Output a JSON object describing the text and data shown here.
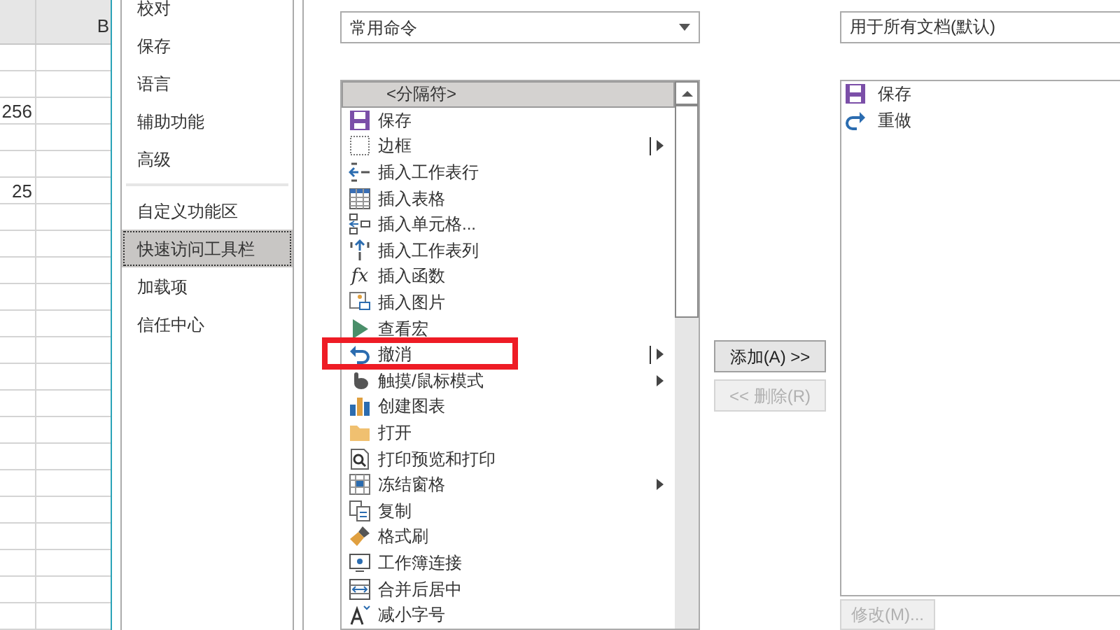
{
  "spreadsheet": {
    "column_header": "B",
    "values": [
      {
        "text": "256"
      },
      {
        "text": "25"
      }
    ]
  },
  "nav": {
    "items": [
      {
        "label": "校对",
        "selected": false
      },
      {
        "label": "保存",
        "selected": false
      },
      {
        "label": "语言",
        "selected": false
      },
      {
        "label": "辅助功能",
        "selected": false
      },
      {
        "label": "高级",
        "selected": false
      },
      {
        "label": "自定义功能区",
        "selected": false
      },
      {
        "label": "快速访问工具栏",
        "selected": true
      },
      {
        "label": "加载项",
        "selected": false
      },
      {
        "label": "信任中心",
        "selected": false
      }
    ]
  },
  "commands": {
    "dropdown": {
      "value": "常用命令"
    },
    "items": [
      {
        "label": "<分隔符>",
        "kind": "separator",
        "selected": true
      },
      {
        "label": "保存",
        "kind": "plain",
        "selected": false
      },
      {
        "label": "边框",
        "kind": "split",
        "selected": false
      },
      {
        "label": "插入工作表行",
        "kind": "plain",
        "selected": false
      },
      {
        "label": "插入表格",
        "kind": "plain",
        "selected": false
      },
      {
        "label": "插入单元格...",
        "kind": "plain",
        "selected": false
      },
      {
        "label": "插入工作表列",
        "kind": "plain",
        "selected": false
      },
      {
        "label": "插入函数",
        "kind": "plain",
        "selected": false,
        "icon_text": "fx"
      },
      {
        "label": "插入图片",
        "kind": "plain",
        "selected": false
      },
      {
        "label": "查看宏",
        "kind": "plain",
        "selected": false
      },
      {
        "label": "撤消",
        "kind": "split",
        "selected": false
      },
      {
        "label": "触摸/鼠标模式",
        "kind": "submenu",
        "selected": false
      },
      {
        "label": "创建图表",
        "kind": "plain",
        "selected": false
      },
      {
        "label": "打开",
        "kind": "plain",
        "selected": false
      },
      {
        "label": "打印预览和打印",
        "kind": "plain",
        "selected": false
      },
      {
        "label": "冻结窗格",
        "kind": "submenu",
        "selected": false
      },
      {
        "label": "复制",
        "kind": "plain",
        "selected": false
      },
      {
        "label": "格式刷",
        "kind": "plain",
        "selected": false
      },
      {
        "label": "工作簿连接",
        "kind": "plain",
        "selected": false
      },
      {
        "label": "合并后居中",
        "kind": "plain",
        "selected": false
      },
      {
        "label": "减小字号",
        "kind": "plain",
        "selected": false
      }
    ]
  },
  "add_button": {
    "label": "添加(A) >>",
    "disabled": false
  },
  "remove_button": {
    "label": "<< 删除(R)",
    "disabled": true
  },
  "toolbar": {
    "dropdown": {
      "value": "用于所有文档(默认)"
    },
    "items": [
      {
        "label": "保存"
      },
      {
        "label": "重做"
      }
    ]
  },
  "modify_button": {
    "label": "修改(M)...",
    "disabled": true
  }
}
